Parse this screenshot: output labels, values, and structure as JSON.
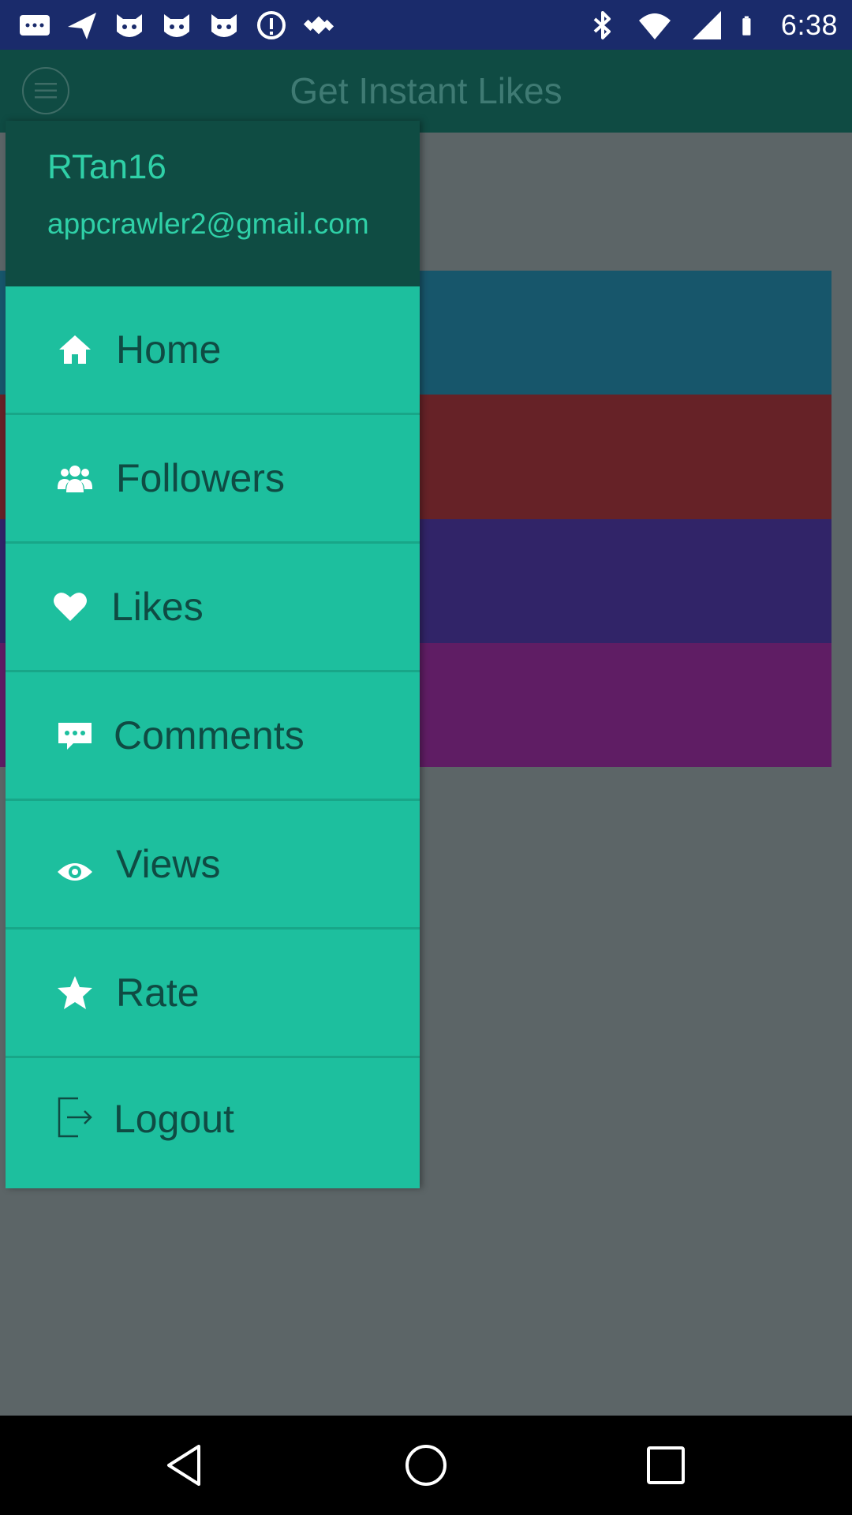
{
  "status_bar": {
    "time": "6:38",
    "icons_left": [
      "message-icon",
      "send-icon",
      "cat-icon",
      "cat-icon",
      "cat-icon",
      "info-icon",
      "fake-gps-icon"
    ],
    "icons_right": [
      "bluetooth-icon",
      "wifi-icon",
      "signal-icon",
      "battery-icon"
    ]
  },
  "app_bar": {
    "title": "Get Instant Likes",
    "menu_icon": "hamburger-menu-icon"
  },
  "drawer": {
    "header": {
      "username": "RTan16",
      "email": "appcrawler2@gmail.com"
    },
    "items": [
      {
        "label": "Home",
        "icon": "home-icon"
      },
      {
        "label": "Followers",
        "icon": "users-icon"
      },
      {
        "label": "Likes",
        "icon": "heart-icon"
      },
      {
        "label": "Comments",
        "icon": "comment-icon"
      },
      {
        "label": "Views",
        "icon": "eye-icon"
      },
      {
        "label": "Rate",
        "icon": "star-icon"
      },
      {
        "label": "Logout",
        "icon": "logout-icon"
      }
    ]
  },
  "background_cards": [
    {
      "color": "#17566b"
    },
    {
      "color": "#662227"
    },
    {
      "color": "#312468"
    },
    {
      "color": "#5f1d64"
    }
  ],
  "colors": {
    "drawer_menu": "#1dbf9e",
    "drawer_header": "#0f4c43",
    "accent_text": "#2fd0a7",
    "status_bar": "#1a2b6b"
  },
  "nav_bar": {
    "buttons": [
      "back-icon",
      "home-icon",
      "recents-icon"
    ]
  }
}
